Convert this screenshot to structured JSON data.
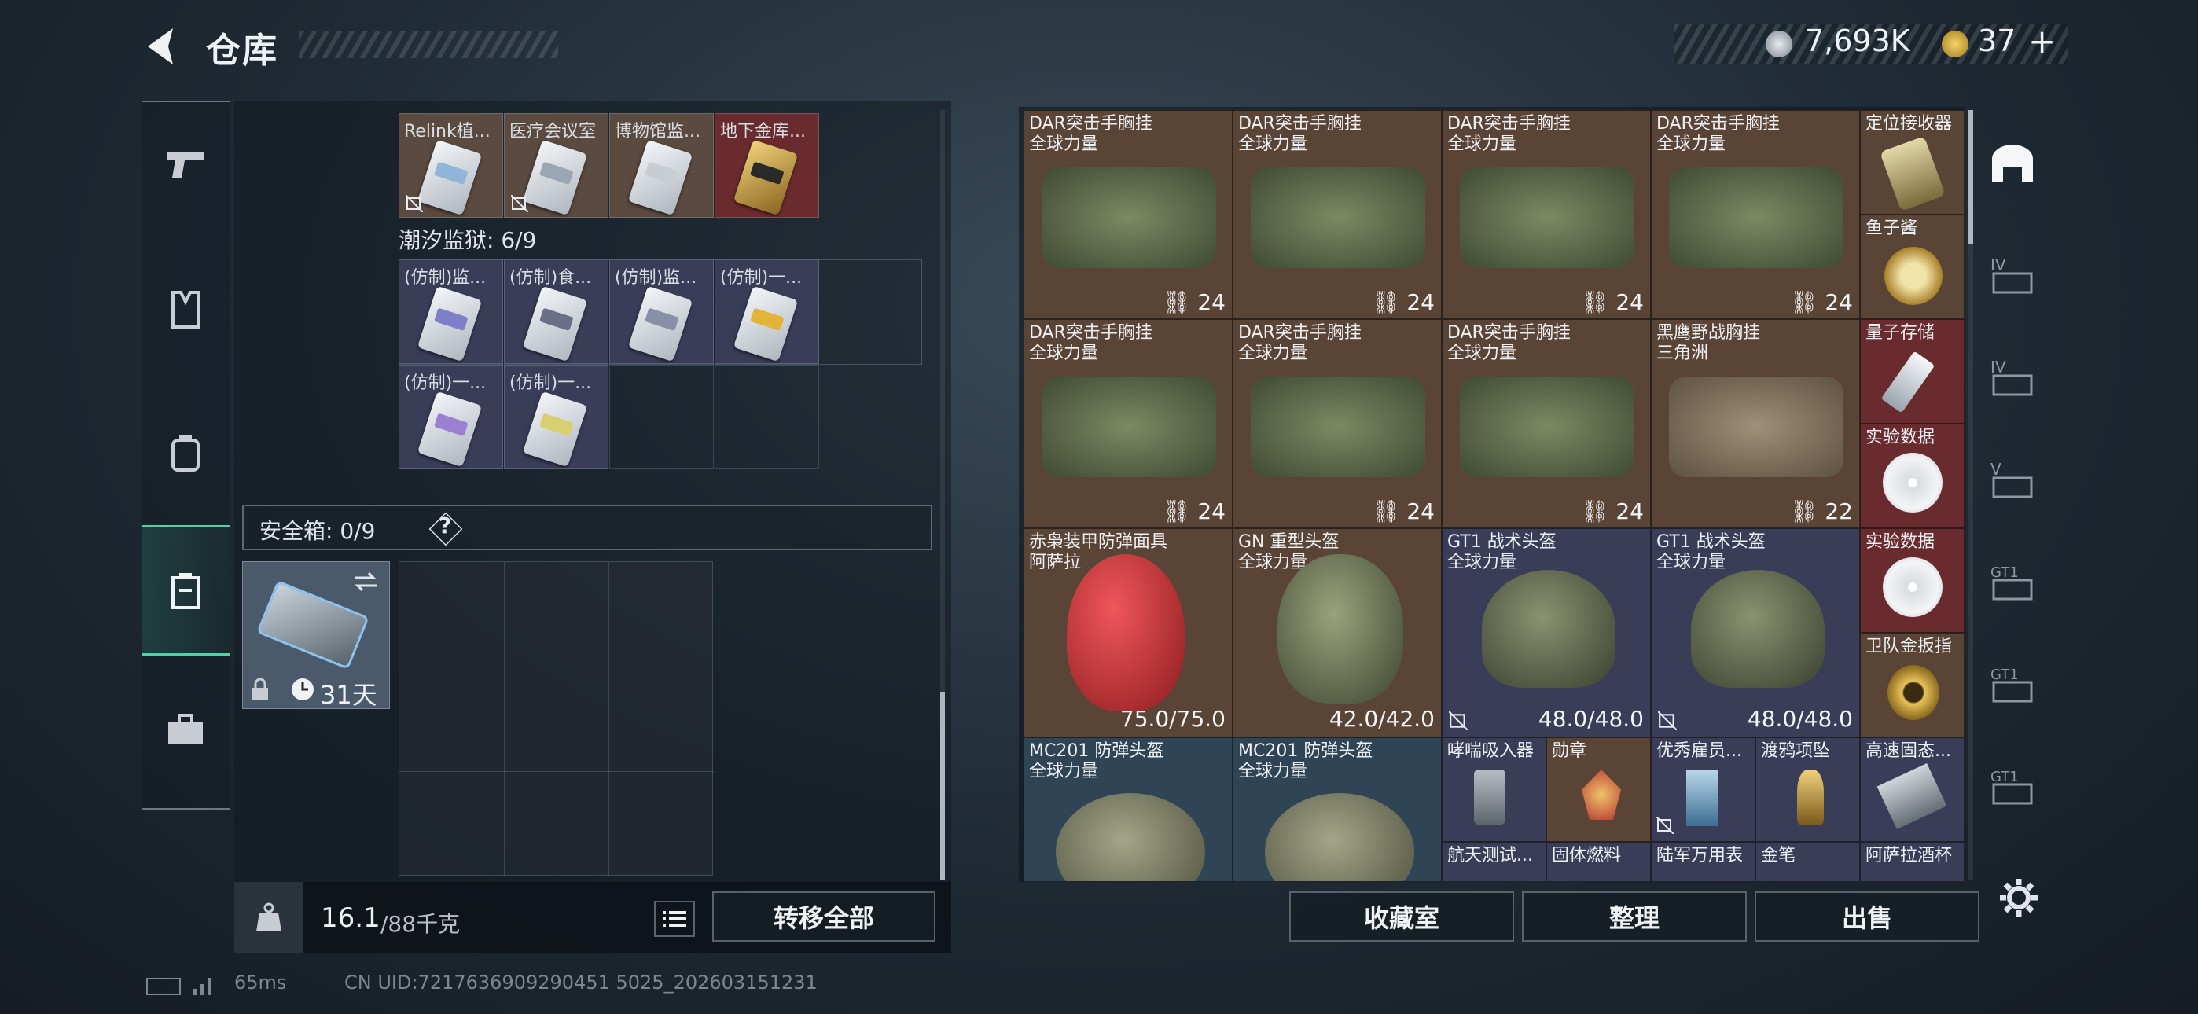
{
  "header": {
    "title": "仓库"
  },
  "currency": {
    "silver": "7,693K",
    "gold": "37"
  },
  "left_nav": [
    "pistol-icon",
    "vest-icon",
    "backpack-icon",
    "safebox-icon",
    "toolbox-icon"
  ],
  "left_panel": {
    "top_row_items": [
      "Relink植...",
      "医疗会议室",
      "博物馆监...",
      "地下金库..."
    ],
    "prison_section": "潮汐监狱: 6/9",
    "prison_items_row1": [
      "(仿制)监...",
      "(仿制)食...",
      "(仿制)监...",
      "(仿制)一..."
    ],
    "prison_items_row2": [
      "(仿制)一...",
      "(仿制)一..."
    ],
    "safebox_label": "安全箱: 0/9",
    "safebox_help": "?",
    "safebox_days": "31天",
    "weight_value": "16.1",
    "weight_cap": "/88千克",
    "transfer_all": "转移全部"
  },
  "right_panel": {
    "rows": [
      [
        {
          "name": "DAR突击手胸挂\n全球力量",
          "qty": "24"
        },
        {
          "name": "DAR突击手胸挂\n全球力量",
          "qty": "24"
        },
        {
          "name": "DAR突击手胸挂\n全球力量",
          "qty": "24"
        },
        {
          "name": "DAR突击手胸挂\n全球力量",
          "qty": "24"
        }
      ],
      [
        {
          "name": "DAR突击手胸挂\n全球力量",
          "qty": "24"
        },
        {
          "name": "DAR突击手胸挂\n全球力量",
          "qty": "24"
        },
        {
          "name": "DAR突击手胸挂\n全球力量",
          "qty": "24"
        },
        {
          "name": "黑鹰野战胸挂\n三角洲",
          "qty": "22"
        }
      ],
      [
        {
          "name": "赤枭装甲防弹面具\n阿萨拉",
          "dur": "75.0/75.0"
        },
        {
          "name": "GN 重型头盔\n全球力量",
          "dur": "42.0/42.0"
        },
        {
          "name": "GT1 战术头盔\n全球力量",
          "dur": "48.0/48.0"
        },
        {
          "name": "GT1 战术头盔\n全球力量",
          "dur": "48.0/48.0"
        }
      ],
      [
        {
          "name": "MC201 防弹头盔\n全球力量"
        },
        {
          "name": "MC201 防弹头盔\n全球力量"
        }
      ]
    ],
    "small_items": [
      "哮喘吸入器",
      "勋章",
      "航天测试...",
      "固体燃料",
      "优秀雇员...",
      "渡鸦项坠",
      "陆军万用表",
      "金笔"
    ],
    "side_column": [
      "定位接收器",
      "鱼子酱",
      "量子存储",
      "实验数据",
      "实验数据",
      "卫队金扳指",
      "高速固态...",
      "阿萨拉酒杯"
    ],
    "buttons": {
      "collection": "收藏室",
      "sort": "整理",
      "sell": "出售"
    }
  },
  "right_nav": [
    "armor-tab-icon",
    "iv-tab-icon",
    "iv-tab-icon",
    "v-tab-icon",
    "gt1-tab-icon",
    "gt1-tab-icon",
    "gt1-tab-icon"
  ],
  "status_bar": {
    "ping": "65ms",
    "uid": "CN UID:7217636909290451 5025_202603151231"
  },
  "colors": {
    "accent_green": "#4fd3a0",
    "cell_brown": "#5a4436",
    "cell_blue": "#3a3d58",
    "cell_red": "#6a2b2e"
  }
}
